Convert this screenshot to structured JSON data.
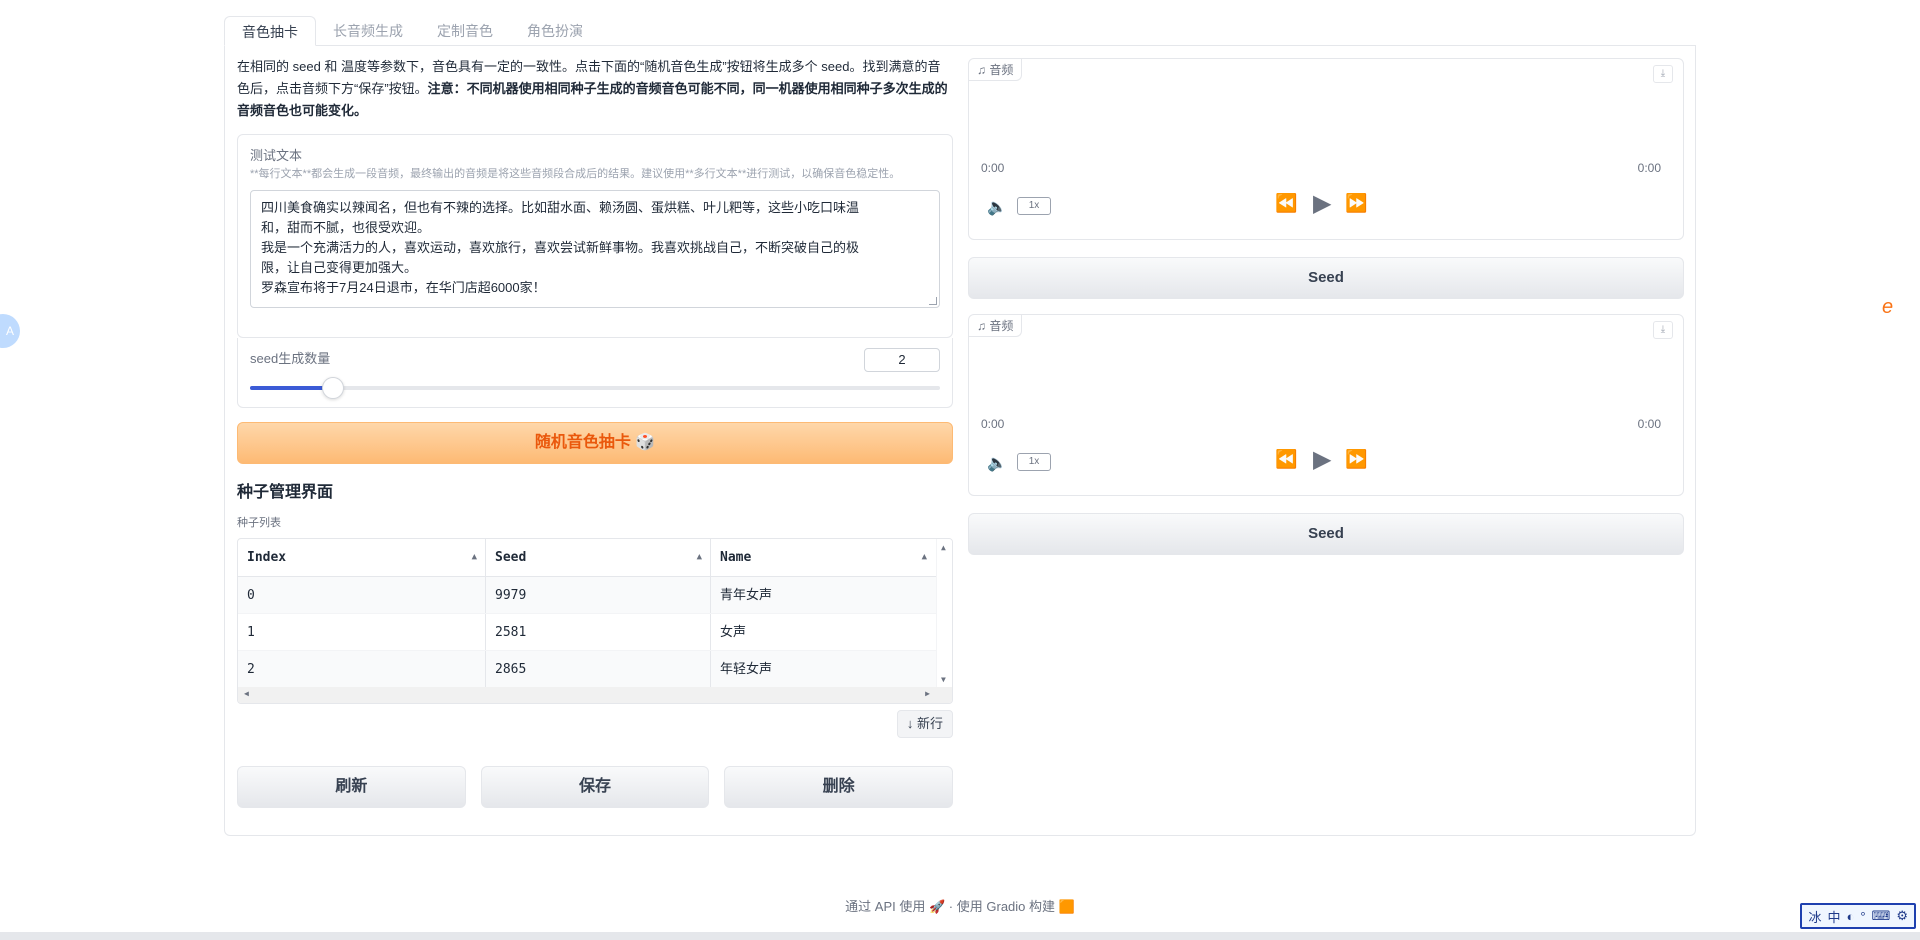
{
  "tabs": [
    "音色抽卡",
    "长音频生成",
    "定制音色",
    "角色扮演"
  ],
  "intro": {
    "normal": "在相同的 seed 和 温度等参数下，音色具有一定的一致性。点击下面的“随机音色生成”按钮将生成多个 seed。找到满意的音色后，点击音频下方“保存”按钮。",
    "bold": "注意：不同机器使用相同种子生成的音频音色可能不同，同一机器使用相同种子多次生成的音频音色也可能变化。"
  },
  "text_input": {
    "label": "测试文本",
    "info": "**每行文本**都会生成一段音频，最终输出的音频是将这些音频段合成后的结果。建议使用**多行文本**进行测试，以确保音色稳定性。",
    "lines": [
      "四川美食确实以辣闻名，但也有不辣的选择。比如甜水面、赖汤圆、蛋烘糕、叶儿粑等，这些小吃口味温",
      "和，甜而不腻，也很受欢迎。",
      "我是一个充满活力的人，喜欢运动，喜欢旅行，喜欢尝试新鲜事物。我喜欢挑战自己，不断突破自己的极",
      "限，让自己变得更加强大。",
      "罗森宣布将于7月24日退市，在华门店超6000家！"
    ]
  },
  "seed_slider": {
    "label": "seed生成数量",
    "value": "2",
    "fraction": 0.12
  },
  "random_button": "随机音色抽卡 🎲",
  "seed_manager": {
    "title": "种子管理界面",
    "table_label": "种子列表",
    "columns": [
      "Index",
      "Seed",
      "Name"
    ],
    "rows": [
      [
        "0",
        "9979",
        "青年女声"
      ],
      [
        "1",
        "2581",
        "女声"
      ],
      [
        "2",
        "2865",
        "年轻女声"
      ]
    ],
    "new_row": "↓ 新行",
    "buttons": [
      "刷新",
      "保存",
      "删除"
    ]
  },
  "audio_players": [
    {
      "label": "音频",
      "time_start": "0:00",
      "time_end": "0:00",
      "rate": "1x",
      "seed_button": "Seed"
    },
    {
      "label": "音频",
      "time_start": "0:00",
      "time_end": "0:00",
      "rate": "1x",
      "seed_button": "Seed"
    }
  ],
  "footer": {
    "api": "通过 API 使用",
    "sep": "·",
    "built": "使用 Gradio 构建"
  },
  "ime": [
    "冰",
    "中"
  ],
  "colors": {
    "accent": "#ea580c",
    "slider": "#3b5bd6"
  }
}
